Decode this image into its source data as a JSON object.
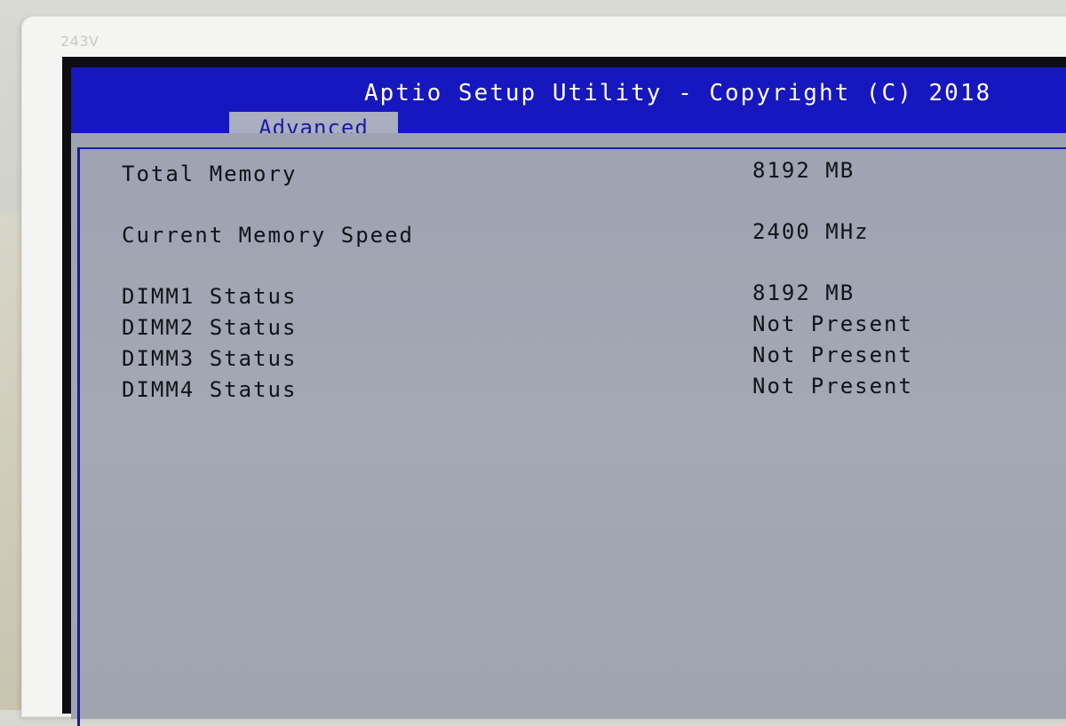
{
  "monitor": {
    "model": "243V"
  },
  "header": {
    "title": "Aptio Setup Utility - Copyright (C) 2018"
  },
  "tabs": [
    {
      "label": "Advanced",
      "active": true
    }
  ],
  "memory": {
    "rows": [
      {
        "label": "Total Memory",
        "value": "8192 MB"
      },
      {
        "label": "Current Memory Speed",
        "value": "2400 MHz"
      },
      {
        "label": "DIMM1 Status",
        "value": "8192 MB"
      },
      {
        "label": "DIMM2 Status",
        "value": "Not Present"
      },
      {
        "label": "DIMM3 Status",
        "value": "Not Present"
      },
      {
        "label": "DIMM4 Status",
        "value": "Not Present"
      }
    ]
  },
  "colors": {
    "header_bg": "#1717bf",
    "tab_bg": "#a9aec0",
    "tab_text": "#1a1aa0",
    "content_bg": "#a3a8b4",
    "text": "#121218"
  }
}
